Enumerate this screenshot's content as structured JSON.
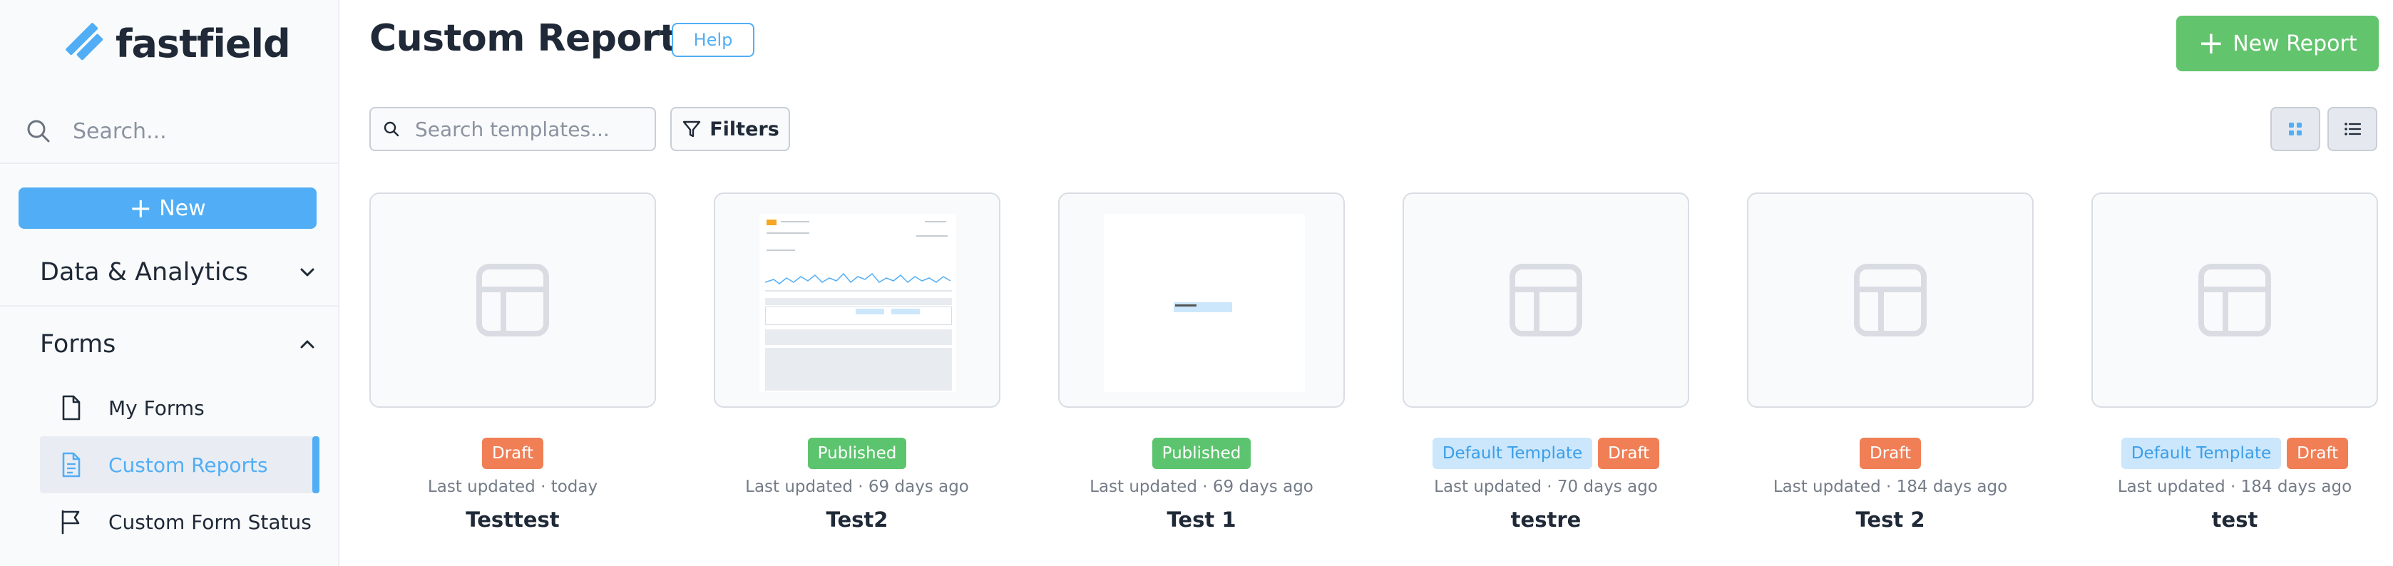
{
  "brand": {
    "name": "fastfield",
    "logo_color": "#51aef6"
  },
  "sidebar": {
    "search_placeholder": "Search...",
    "new_label": "New",
    "sections": [
      {
        "label": "Data & Analytics",
        "expanded": false
      },
      {
        "label": "Forms",
        "expanded": true
      }
    ],
    "forms_items": [
      {
        "label": "My Forms",
        "icon": "file-icon",
        "active": false
      },
      {
        "label": "Custom Reports",
        "icon": "file-text-icon",
        "active": true
      },
      {
        "label": "Custom Form Status",
        "icon": "flag-icon",
        "active": false
      }
    ]
  },
  "header": {
    "title": "Custom Reports",
    "help_label": "Help",
    "new_report_label": "New Report"
  },
  "toolbar": {
    "search_placeholder": "Search templates...",
    "filters_label": "Filters",
    "view_mode": "grid"
  },
  "colors": {
    "accent": "#51aef6",
    "success": "#62c46d",
    "draft": "#f07f56",
    "published": "#5cc46e",
    "default_badge_bg": "#cce7fb"
  },
  "cards": [
    {
      "name": "Testtest",
      "updated": "Last updated · today",
      "badges": [
        {
          "label": "Draft",
          "kind": "draft"
        }
      ],
      "thumbnail": "placeholder"
    },
    {
      "name": "Test2",
      "updated": "Last updated · 69 days ago",
      "badges": [
        {
          "label": "Published",
          "kind": "published"
        }
      ],
      "thumbnail": "report-preview"
    },
    {
      "name": "Test 1",
      "updated": "Last updated · 69 days ago",
      "badges": [
        {
          "label": "Published",
          "kind": "published"
        }
      ],
      "thumbnail": "blank-preview"
    },
    {
      "name": "testre",
      "updated": "Last updated · 70 days ago",
      "badges": [
        {
          "label": "Default Template",
          "kind": "default"
        },
        {
          "label": "Draft",
          "kind": "draft"
        }
      ],
      "thumbnail": "placeholder"
    },
    {
      "name": "Test 2",
      "updated": "Last updated · 184 days ago",
      "badges": [
        {
          "label": "Draft",
          "kind": "draft"
        }
      ],
      "thumbnail": "placeholder"
    },
    {
      "name": "test",
      "updated": "Last updated · 184 days ago",
      "badges": [
        {
          "label": "Default Template",
          "kind": "default"
        },
        {
          "label": "Draft",
          "kind": "draft"
        }
      ],
      "thumbnail": "placeholder"
    }
  ]
}
